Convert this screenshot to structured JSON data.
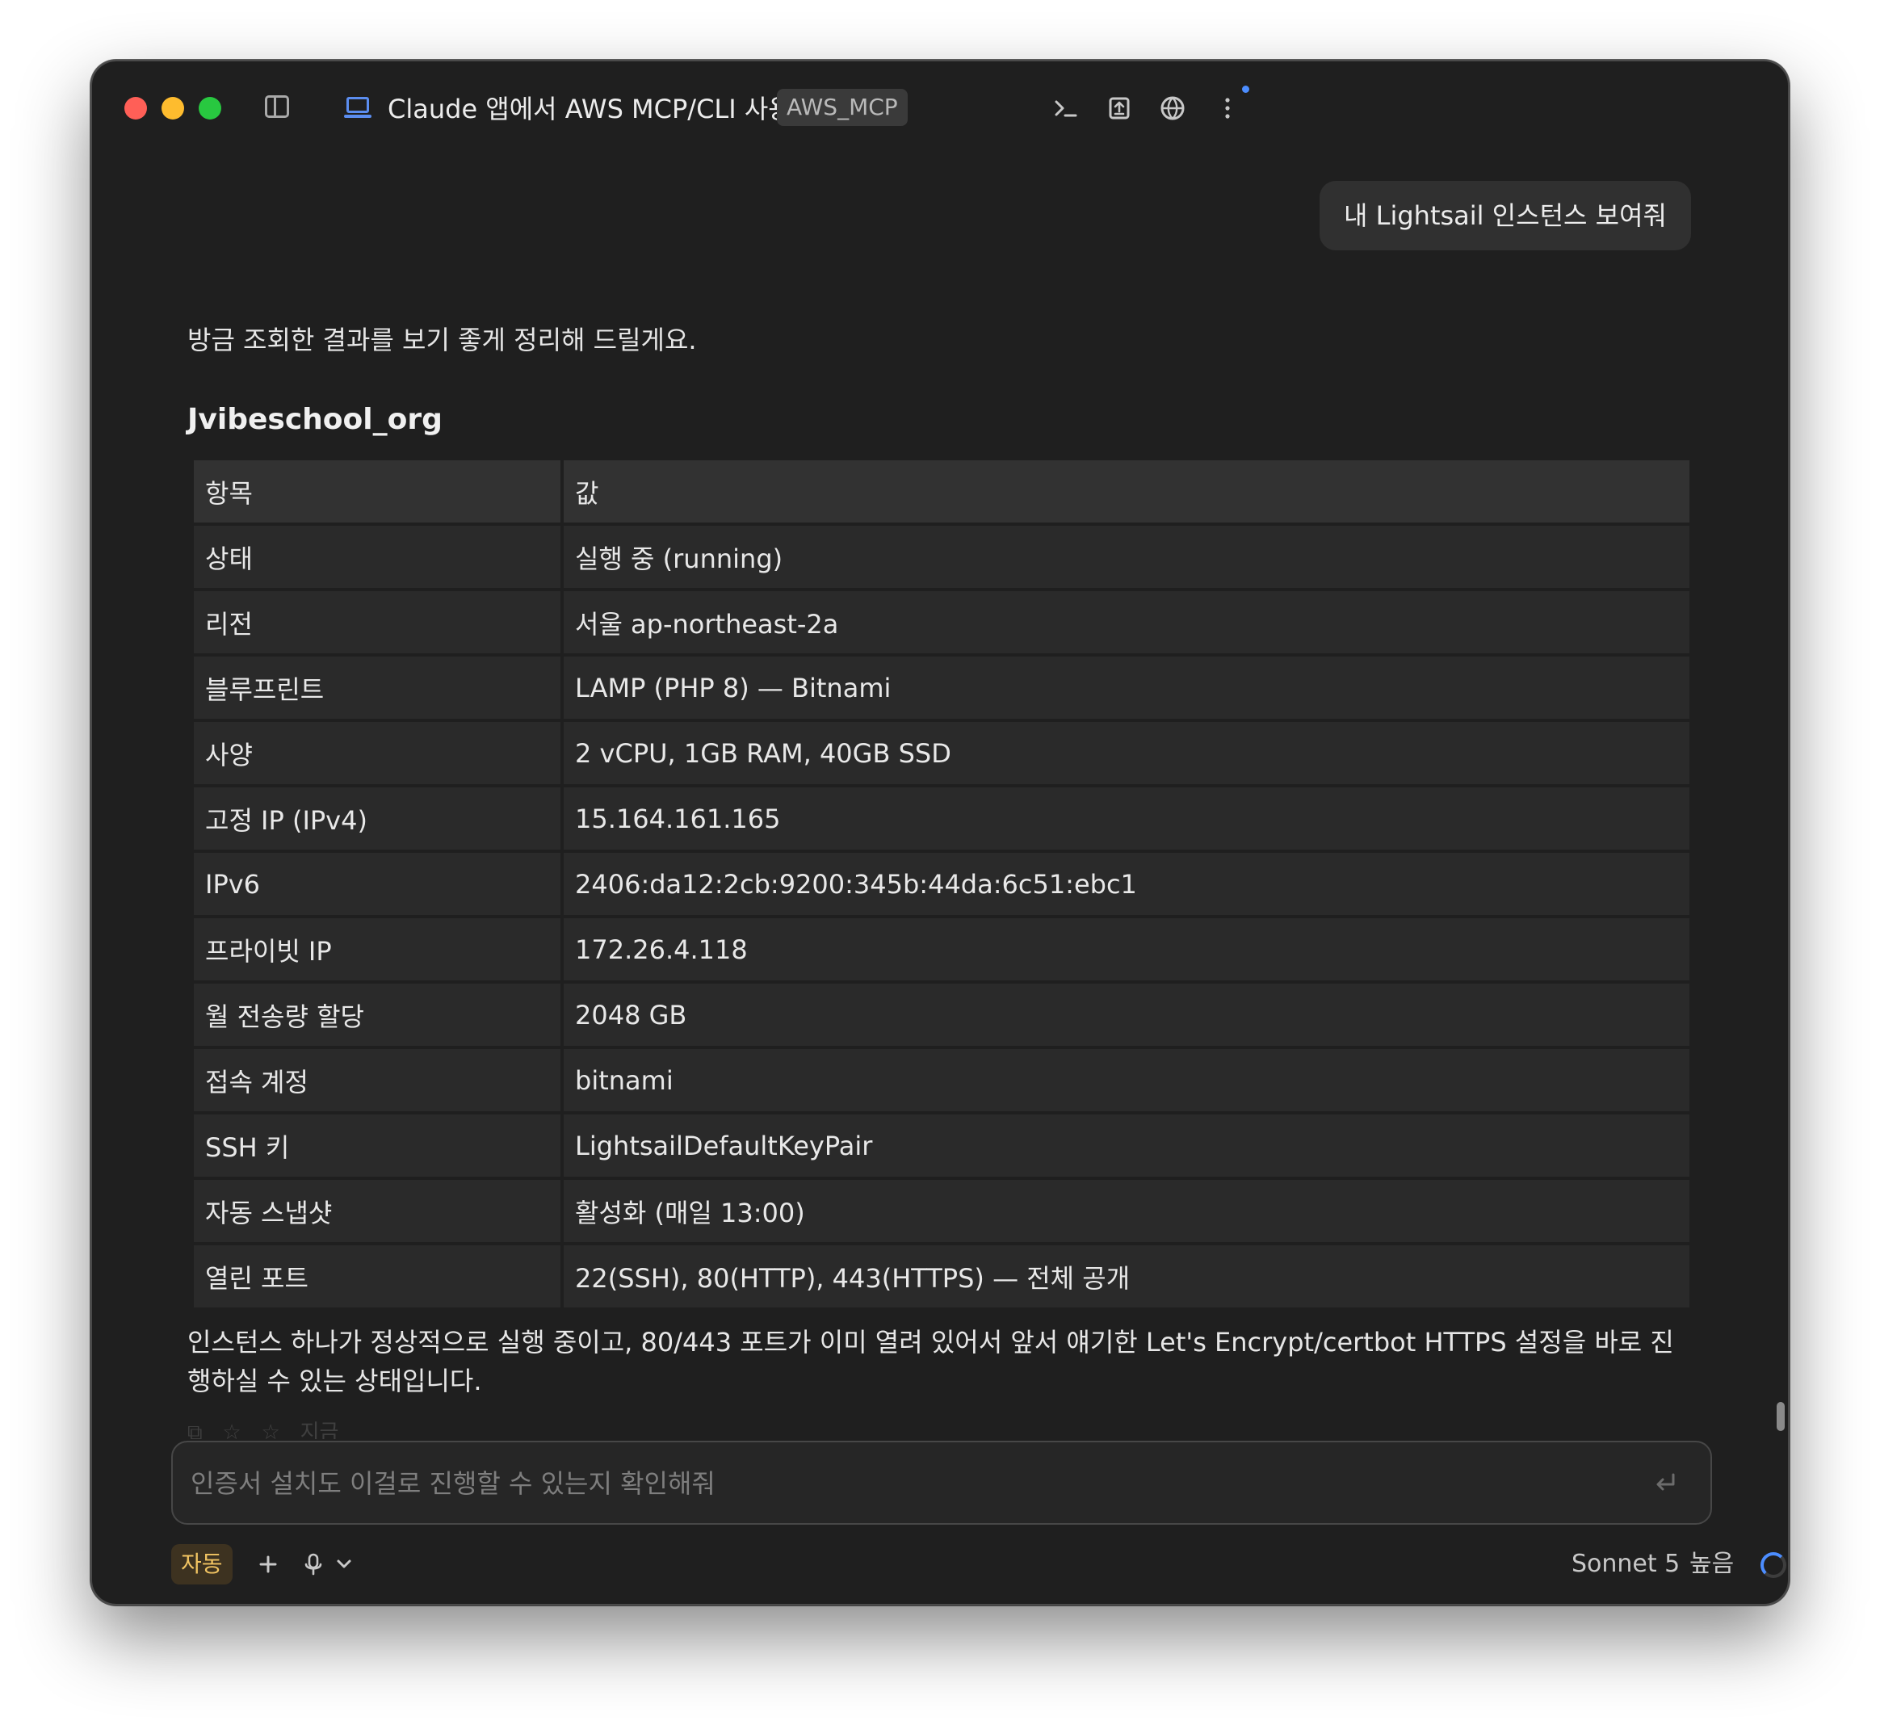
{
  "window": {
    "title": "Claude 앱에서 AWS MCP/CLI 사용",
    "badge": "AWS_MCP"
  },
  "toolbar": {
    "icons": [
      "terminal-icon",
      "export-icon",
      "globe-icon",
      "more-vertical-icon"
    ]
  },
  "chat": {
    "user_message": "내 Lightsail 인스턴스 보여줘",
    "intro": "방금 조회한 결과를 보기 좋게 정리해 드릴게요.",
    "instance_title": "Jvibeschool_org",
    "table": {
      "header": {
        "key": "항목",
        "value": "값"
      },
      "rows": [
        {
          "key": "상태",
          "value": "실행 중 (running)"
        },
        {
          "key": "리전",
          "value": "서울 ap-northeast-2a"
        },
        {
          "key": "블루프린트",
          "value": "LAMP (PHP 8) — Bitnami"
        },
        {
          "key": "사양",
          "value": "2 vCPU, 1GB RAM, 40GB SSD"
        },
        {
          "key": "고정 IP (IPv4)",
          "value": "15.164.161.165"
        },
        {
          "key": "IPv6",
          "value": "2406:da12:2cb:9200:345b:44da:6c51:ebc1"
        },
        {
          "key": "프라이빗 IP",
          "value": "172.26.4.118"
        },
        {
          "key": "월 전송량 할당",
          "value": "2048 GB"
        },
        {
          "key": "접속 계정",
          "value": "bitnami"
        },
        {
          "key": "SSH 키",
          "value": "LightsailDefaultKeyPair"
        },
        {
          "key": "자동 스냅샷",
          "value": "활성화 (매일 13:00)"
        },
        {
          "key": "열린 포트",
          "value": "22(SSH), 80(HTTP), 443(HTTPS) — 전체 공개"
        }
      ]
    },
    "summary": "인스턴스 하나가 정상적으로 실행 중이고, 80/443 포트가 이미 열려 있어서 앞서 얘기한 Let's Encrypt/certbot HTTPS 설정을 바로 진행하실 수 있는 상태입니다.",
    "faded_actions_label": "지금"
  },
  "composer": {
    "value": "",
    "placeholder": "인증서 설치도 이걸로 진행할 수 있는지 확인해줘"
  },
  "bottom_bar": {
    "mode": "자동",
    "model": "Sonnet 5",
    "effort": "높음"
  },
  "colors": {
    "window_bg": "#1f1f1f",
    "accent_blue": "#4c8dff",
    "mode_badge_text": "#f2c462"
  }
}
